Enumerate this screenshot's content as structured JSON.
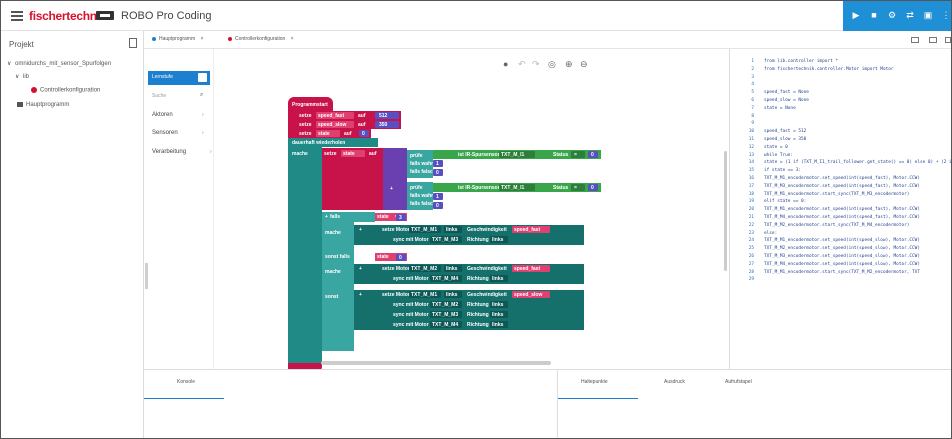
{
  "app": {
    "brand": "fischertechnik",
    "title": "ROBO Pro Coding"
  },
  "project": {
    "header": "Projekt",
    "tree": [
      {
        "label": "omnidurchs_mit_sensor_Spurfolgen",
        "level": 0
      },
      {
        "label": "lib",
        "level": 1
      },
      {
        "label": "Controllerkonfiguration",
        "level": 2
      },
      {
        "label": "Hauptprogramm",
        "level": 1
      }
    ]
  },
  "tabs": [
    {
      "label": "Hauptprogramm",
      "close": "×",
      "dot": "#1c7fd0"
    },
    {
      "label": "Controllerkonfiguration",
      "close": "×",
      "dot": "#d7102c"
    }
  ],
  "toolbox": {
    "level_tab": "Lernstufe",
    "search": "Suche",
    "categories": [
      "Aktoren",
      "Sensoren",
      "Verarbeitung"
    ]
  },
  "blocks": {
    "prog_start": "Programmstart",
    "set": "setze",
    "on": "auf",
    "var1": "speed_fast",
    "val1": "512",
    "var2": "speed_slow",
    "val2": "350",
    "var3": "state",
    "val3": "0",
    "forever": "dauerhaft wiederholen",
    "do": "mache",
    "check": "prüfe",
    "if_true": "falls wahr",
    "if_false": "falls falsch",
    "sensor": "ist IR-Spursensor",
    "sensor_port": "TXT_M_I1",
    "status": "Status",
    "zero": "0",
    "one": "1",
    "three": "3",
    "plus": "+",
    "if": "falls",
    "else_if": "sonst falls",
    "else": "sonst",
    "state_var": "state",
    "eq": "=",
    "set_motor": "setze Motor",
    "sync_motor": "sync mit Motor",
    "m1": "TXT_M_M1",
    "m2": "TXT_M_M2",
    "m3": "TXT_M_M3",
    "m4": "TXT_M_M4",
    "direction": "links",
    "speed_label": "Geschwindigkeit",
    "dir_label": "Richtung"
  },
  "code": [
    "from lib.controller import *",
    "from fischertechnik.controller.Motor import Motor",
    "",
    "",
    "speed_fast = None",
    "speed_slow = None",
    "state = None",
    "",
    "",
    "speed_fast = 512",
    "speed_slow = 350",
    "state = 0",
    "while True:",
    "    state = (1 if (TXT_M_I1_trail_follower.get_state() == 0) else 0) + (2 if (TXT",
    "    if state == 3:",
    "        TXT_M_M1_encodermotor.set_speed(int(speed_fast), Motor.CCW)",
    "        TXT_M_M3_encodermotor.set_speed(int(speed_fast), Motor.CCW)",
    "        TXT_M_M1_encodermotor.start_sync(TXT_M_M3_encodermotor)",
    "    elif state == 0:",
    "        TXT_M_M1_encodermotor.set_speed(int(speed_fast), Motor.CCW)",
    "        TXT_M_M4_encodermotor.set_speed(int(speed_fast), Motor.CCW)",
    "        TXT_M_M2_encodermotor.start_sync(TXT_M_M4_encodermotor)",
    "    else:",
    "        TXT_M_M1_encodermotor.set_speed(int(speed_slow), Motor.CCW)",
    "        TXT_M_M2_encodermotor.set_speed(int(speed_slow), Motor.CCW)",
    "        TXT_M_M3_encodermotor.set_speed(int(speed_slow), Motor.CCW)",
    "        TXT_M_M4_encodermotor.set_speed(int(speed_slow), Motor.CCW)",
    "        TXT_M_M1_encodermotor.start_sync(TXT_M_M2_encodermotor, TXT",
    ""
  ],
  "bottom": {
    "console": "Konsole",
    "breakpoints": "Haltepunkte",
    "expression": "Ausdruck",
    "callstack": "Aufrufstapel"
  },
  "colors": {
    "accent": "#1c7fd0",
    "brand_red": "#d7102c",
    "block_red": "#c8134a",
    "block_teal": "#1f8a86"
  }
}
